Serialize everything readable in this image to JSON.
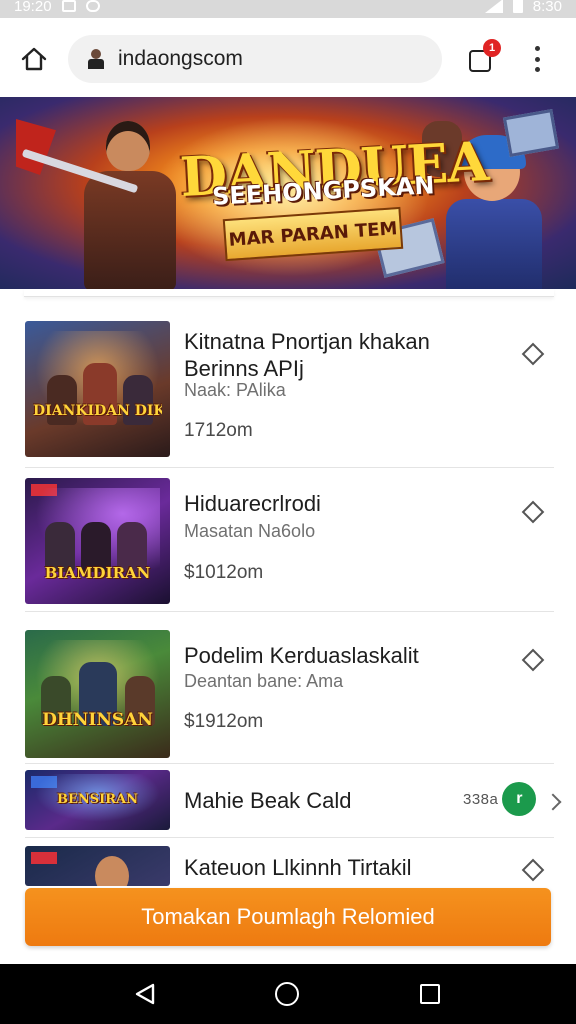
{
  "status_bar": {
    "time": "19:20",
    "time_right": "8:30"
  },
  "browser": {
    "url": "indaongscom",
    "tab_count": "1",
    "icons": {
      "home": "home-icon",
      "lock": "site-icon",
      "tabs": "tabs-icon",
      "menu": "more-vert-icon"
    }
  },
  "banner": {
    "title": "DANDUEA",
    "subtitle": "SEEHONGPSKAN",
    "ribbon": "MAR PARAN TEM"
  },
  "items": [
    {
      "title": "Kitnatna Pnortjan khakan Berinns APIj",
      "meta": "Naak: PAlika",
      "price": "1712om",
      "thumb_logo": "DIANKIDAN DIKDINSEH",
      "action_icon": "diamond-icon"
    },
    {
      "title": "Hiduarecrlrodi",
      "meta": "Masatan Na6olo",
      "price": "$1012om",
      "thumb_logo": "BIAMDIRAN",
      "action_icon": "diamond-icon"
    },
    {
      "title": "Podelim Kerduaslaskalit",
      "meta": "Deantan bane: Ama",
      "price": "$1912om",
      "thumb_logo": "DHNINSAN",
      "action_icon": "diamond-icon"
    },
    {
      "title": "Mahie Beak Cald",
      "pill_text": "338a",
      "pill_icon_letter": "r",
      "thumb_logo": "BENSIRAN",
      "action_icon": "chevron-right-icon"
    },
    {
      "title": "Kateuon Llkinnh Tirtakil",
      "action_icon": "diamond-icon"
    }
  ],
  "cta": {
    "label": "Tomakan Poumlagh Relomied"
  },
  "colors": {
    "cta": "#f08418",
    "badge": "#e02424",
    "pill": "#1b9a4c"
  },
  "nav_icons": {
    "back": "back-icon",
    "home": "home-circle-icon",
    "recents": "recents-icon"
  }
}
